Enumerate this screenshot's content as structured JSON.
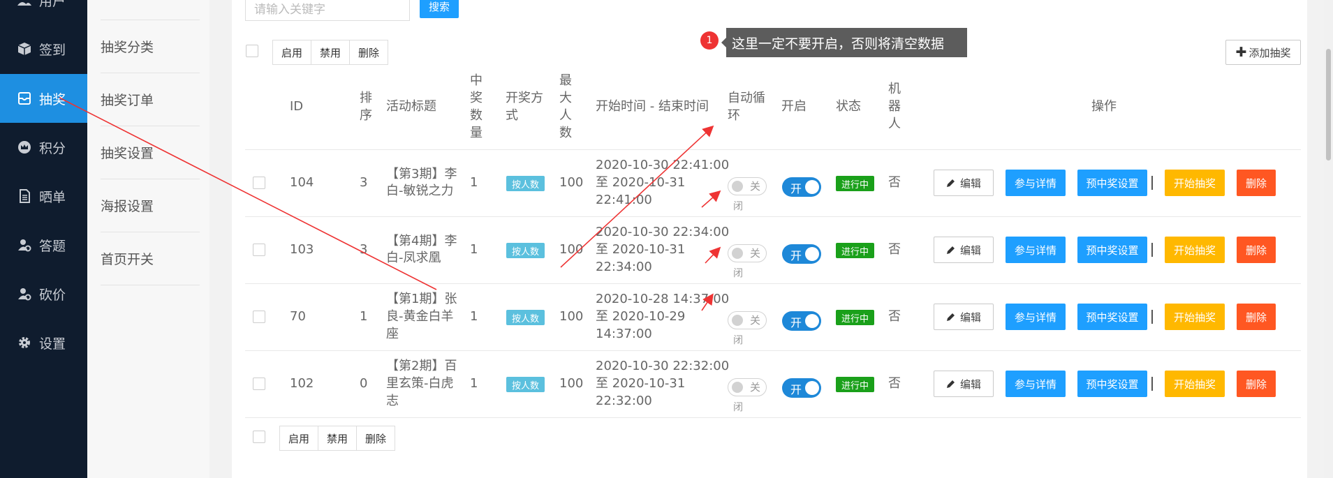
{
  "sidebar": {
    "items": [
      {
        "label": "用户",
        "icon": "users-icon"
      },
      {
        "label": "签到",
        "icon": "cube-icon"
      },
      {
        "label": "抽奖",
        "icon": "gift-icon",
        "active": true
      },
      {
        "label": "积分",
        "icon": "crown-icon"
      },
      {
        "label": "晒单",
        "icon": "document-icon"
      },
      {
        "label": "答题",
        "icon": "user-settings-icon"
      },
      {
        "label": "砍价",
        "icon": "user-settings-icon"
      },
      {
        "label": "设置",
        "icon": "gear-icon"
      }
    ]
  },
  "submenu": {
    "items": [
      "抽奖分类",
      "抽奖订单",
      "抽奖设置",
      "海报设置",
      "首页开关"
    ]
  },
  "toolbar": {
    "search_placeholder": "请输入关键字",
    "search_label": "搜索",
    "enable_label": "启用",
    "disable_label": "禁用",
    "delete_label": "删除",
    "add_label": "添加抽奖"
  },
  "annotation": {
    "badge": "1",
    "text": "这里一定不要开启，否则将清空数据"
  },
  "table": {
    "headers": {
      "id": "ID",
      "sort": "排序",
      "title": "活动标题",
      "prize_count": "中奖数量",
      "draw_mode": "开奖方式",
      "max_people": "最大人数",
      "time": "开始时间 - 结束时间",
      "auto_loop": "自动循环",
      "open": "开启",
      "status": "状态",
      "robot": "机器人",
      "actions": "操作"
    },
    "rows": [
      {
        "id": "104",
        "sort": "3",
        "title_l1": "【第3期】李",
        "title_l2": "白-敏锐之力",
        "title_l3": "",
        "prize_count": "1",
        "draw_mode": "按人数",
        "max_people": "100",
        "time_l1": "2020-10-30 22:41:00",
        "time_l2": "至 2020-10-31",
        "time_l3": "22:41:00",
        "auto_loop_l1": "关",
        "auto_loop_l2": "闭",
        "open": "开",
        "status": "进行中",
        "robot": "否"
      },
      {
        "id": "103",
        "sort": "3",
        "title_l1": "【第4期】李",
        "title_l2": "白-凤求凰",
        "title_l3": "",
        "prize_count": "1",
        "draw_mode": "按人数",
        "max_people": "100",
        "time_l1": "2020-10-30 22:34:00",
        "time_l2": "至 2020-10-31",
        "time_l3": "22:34:00",
        "auto_loop_l1": "关",
        "auto_loop_l2": "闭",
        "open": "开",
        "status": "进行中",
        "robot": "否"
      },
      {
        "id": "70",
        "sort": "1",
        "title_l1": "【第1期】张",
        "title_l2": "良-黄金白羊",
        "title_l3": "座",
        "prize_count": "1",
        "draw_mode": "按人数",
        "max_people": "100",
        "time_l1": "2020-10-28 14:37:00",
        "time_l2": "至 2020-10-29",
        "time_l3": "14:37:00",
        "auto_loop_l1": "关",
        "auto_loop_l2": "闭",
        "open": "开",
        "status": "进行中",
        "robot": "否"
      },
      {
        "id": "102",
        "sort": "0",
        "title_l1": "【第2期】百",
        "title_l2": "里玄策-白虎",
        "title_l3": "志",
        "prize_count": "1",
        "draw_mode": "按人数",
        "max_people": "100",
        "time_l1": "2020-10-30 22:32:00",
        "time_l2": "至 2020-10-31",
        "time_l3": "22:32:00",
        "auto_loop_l1": "关",
        "auto_loop_l2": "闭",
        "open": "开",
        "status": "进行中",
        "robot": "否"
      }
    ],
    "row_actions": {
      "edit": "编辑",
      "participants": "参与详情",
      "preset": "预中奖设置",
      "start": "开始抽奖",
      "delete": "删除"
    }
  },
  "colors": {
    "sidebar_bg": "#0f1c2e",
    "active_blue": "#1e8fe1",
    "primary": "#1e9fff",
    "warning": "#ffb800",
    "danger": "#ff5722",
    "success": "#1aa01a",
    "info": "#5bc0de",
    "annotation_red": "#e33333"
  }
}
